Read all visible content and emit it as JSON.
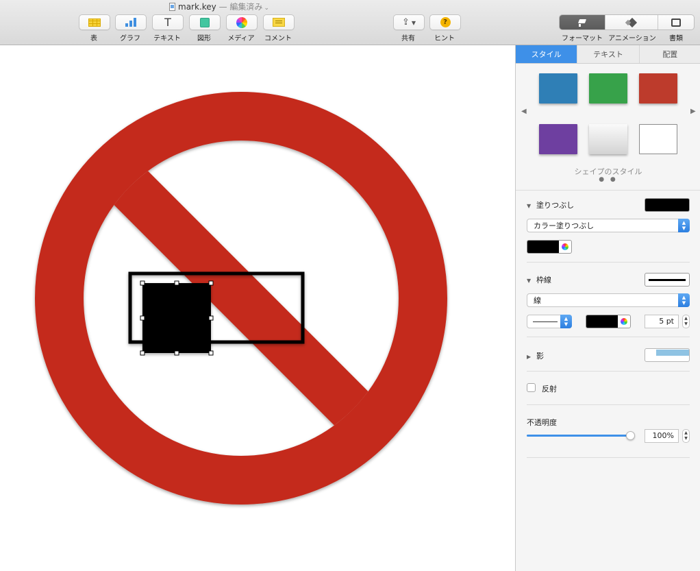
{
  "window": {
    "filename": "mark.key",
    "separator": "—",
    "status": "編集済み"
  },
  "toolbar": {
    "insert": [
      {
        "label": "表",
        "icon": "table-icon"
      },
      {
        "label": "グラフ",
        "icon": "chart-icon"
      },
      {
        "label": "テキスト",
        "icon": "text-icon"
      },
      {
        "label": "図形",
        "icon": "shape-icon"
      },
      {
        "label": "メディア",
        "icon": "media-icon"
      },
      {
        "label": "コメント",
        "icon": "comment-icon"
      }
    ],
    "share_label": "共有",
    "hint_label": "ヒント",
    "hint_glyph": "?",
    "format_label": "フォーマット",
    "animation_label": "アニメーション",
    "document_label": "書類"
  },
  "canvas": {
    "prohibition_color": "#c4291a",
    "selected_shape_color": "#000000",
    "text_box_border_color": "#000000"
  },
  "inspector": {
    "tabs": [
      "スタイル",
      "テキスト",
      "配置"
    ],
    "active_tab": "スタイル",
    "shape_styles": [
      "#2f7fb6",
      "#37a24a",
      "#bd3b2c",
      "#6e3fa0",
      "gradient-gray",
      "outline-white"
    ],
    "shape_styles_caption": "シェイプのスタイル",
    "page_dots": "● ●",
    "fill": {
      "title": "塗りつぶし",
      "color": "#000000",
      "type": "カラー塗りつぶし"
    },
    "border": {
      "title": "枠線",
      "type": "線",
      "color": "#000000",
      "width": "5 pt"
    },
    "shadow": {
      "title": "影"
    },
    "reflection": {
      "label": "反射",
      "checked": false
    },
    "opacity": {
      "title": "不透明度",
      "value": "100%",
      "fraction": 1.0
    },
    "accent_color": "#3e90e8"
  }
}
